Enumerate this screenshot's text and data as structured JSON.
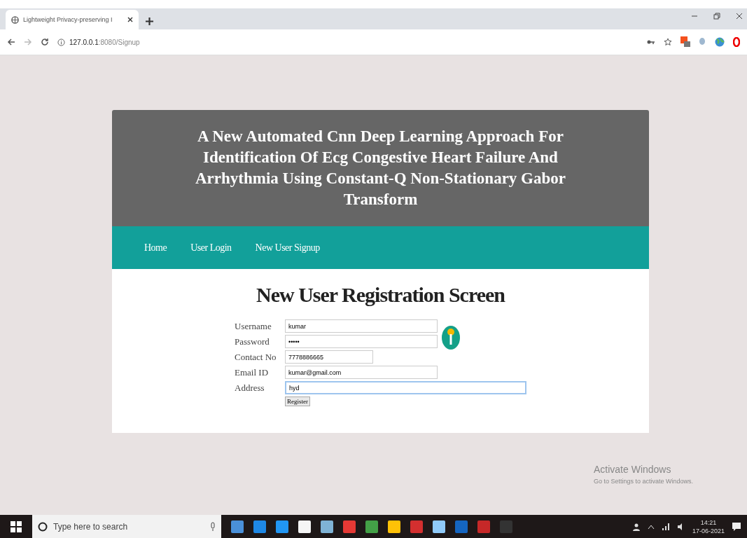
{
  "browser": {
    "tab_title": "Lightweight Privacy-preserving I",
    "url_host": "127.0.0.1",
    "url_rest": ":8080/Signup"
  },
  "page": {
    "title": "A New Automated Cnn Deep Learning Approach For Identification Of Ecg Congestive Heart Failure And Arrhythmia Using Constant-Q Non-Stationary Gabor Transform",
    "nav": [
      {
        "label": "Home"
      },
      {
        "label": "User Login"
      },
      {
        "label": "New User Signup"
      }
    ],
    "heading": "New User Registration Screen",
    "fields": [
      {
        "label": "Username",
        "value": "kumar",
        "kind": "medium",
        "focused": false
      },
      {
        "label": "Password",
        "value": "•••••",
        "kind": "medium",
        "focused": false
      },
      {
        "label": "Contact No",
        "value": "7778886665",
        "kind": "short",
        "focused": false
      },
      {
        "label": "Email ID",
        "value": "kumar@gmail.com",
        "kind": "medium",
        "focused": false
      },
      {
        "label": "Address",
        "value": "hyd",
        "kind": "long",
        "focused": true
      }
    ],
    "button": "Register"
  },
  "watermark": {
    "title": "Activate Windows",
    "subtitle": "Go to Settings to activate Windows."
  },
  "taskbar": {
    "search_placeholder": "Type here to search",
    "time": "14:21",
    "date": "17-06-2021"
  }
}
